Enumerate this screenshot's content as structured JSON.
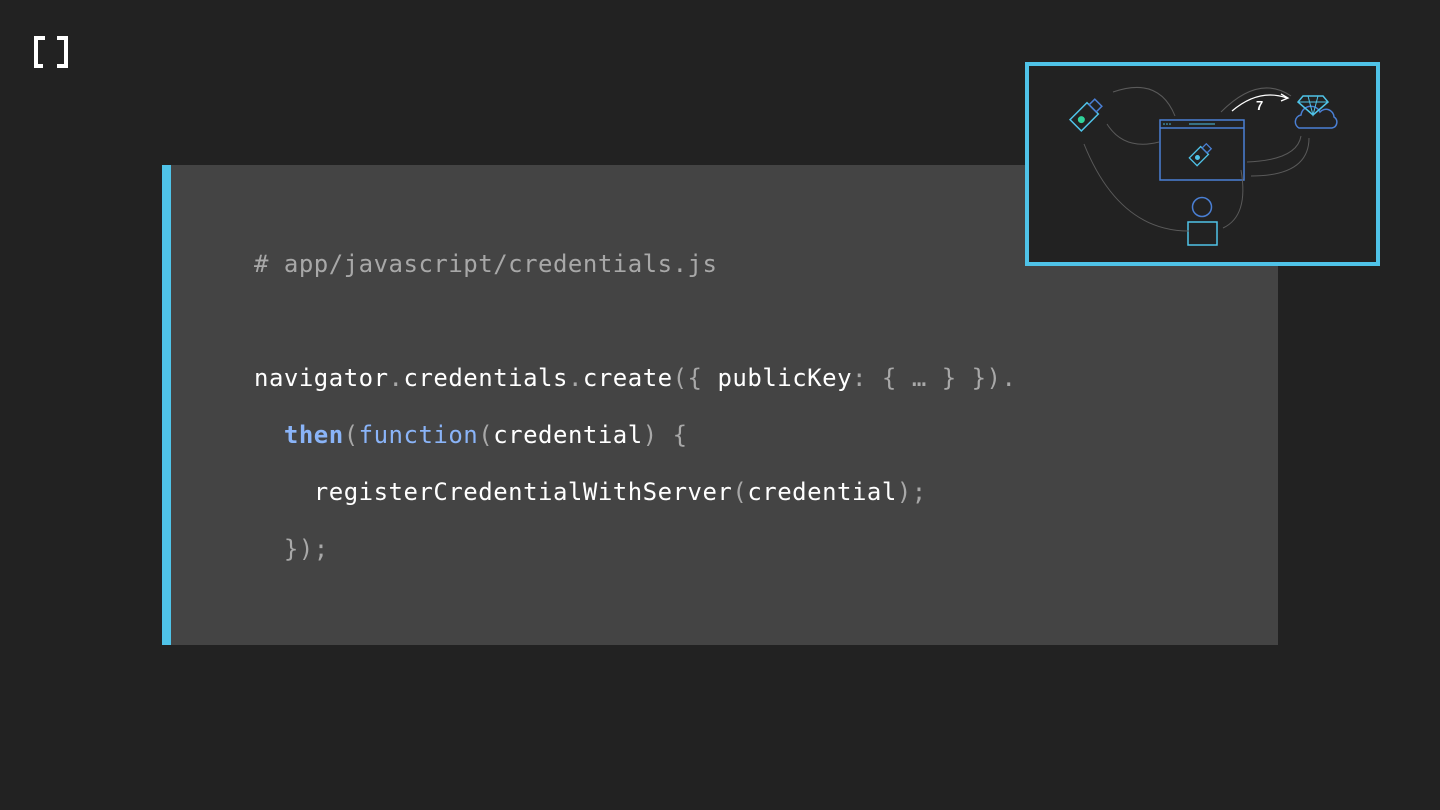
{
  "logo": {
    "icon": "bracket-logo-icon"
  },
  "code": {
    "comment": "# app/javascript/credentials.js",
    "line1": {
      "navigator": "navigator",
      "dot1": ".",
      "credentials": "credentials",
      "dot2": ".",
      "create": "create",
      "open": "({ ",
      "publicKey": "publicKey",
      "rest": ": { … } }).",
      "trail": ""
    },
    "line2": {
      "indent": "  ",
      "then": "then",
      "paren_open": "(",
      "function": "function",
      "paren_open2": "(",
      "credential": "credential",
      "close": ") {"
    },
    "line3": {
      "indent": "    ",
      "register": "registerCredentialWithServer",
      "paren_open": "(",
      "credential": "credential",
      "close": ");"
    },
    "line4": {
      "text": "  });"
    },
    "accent_color": "#4fc3e8"
  },
  "thumbnail": {
    "step_number": "7",
    "icons": [
      "usb-key-icon",
      "browser-window-icon",
      "user-icon",
      "cloud-gem-icon"
    ]
  }
}
